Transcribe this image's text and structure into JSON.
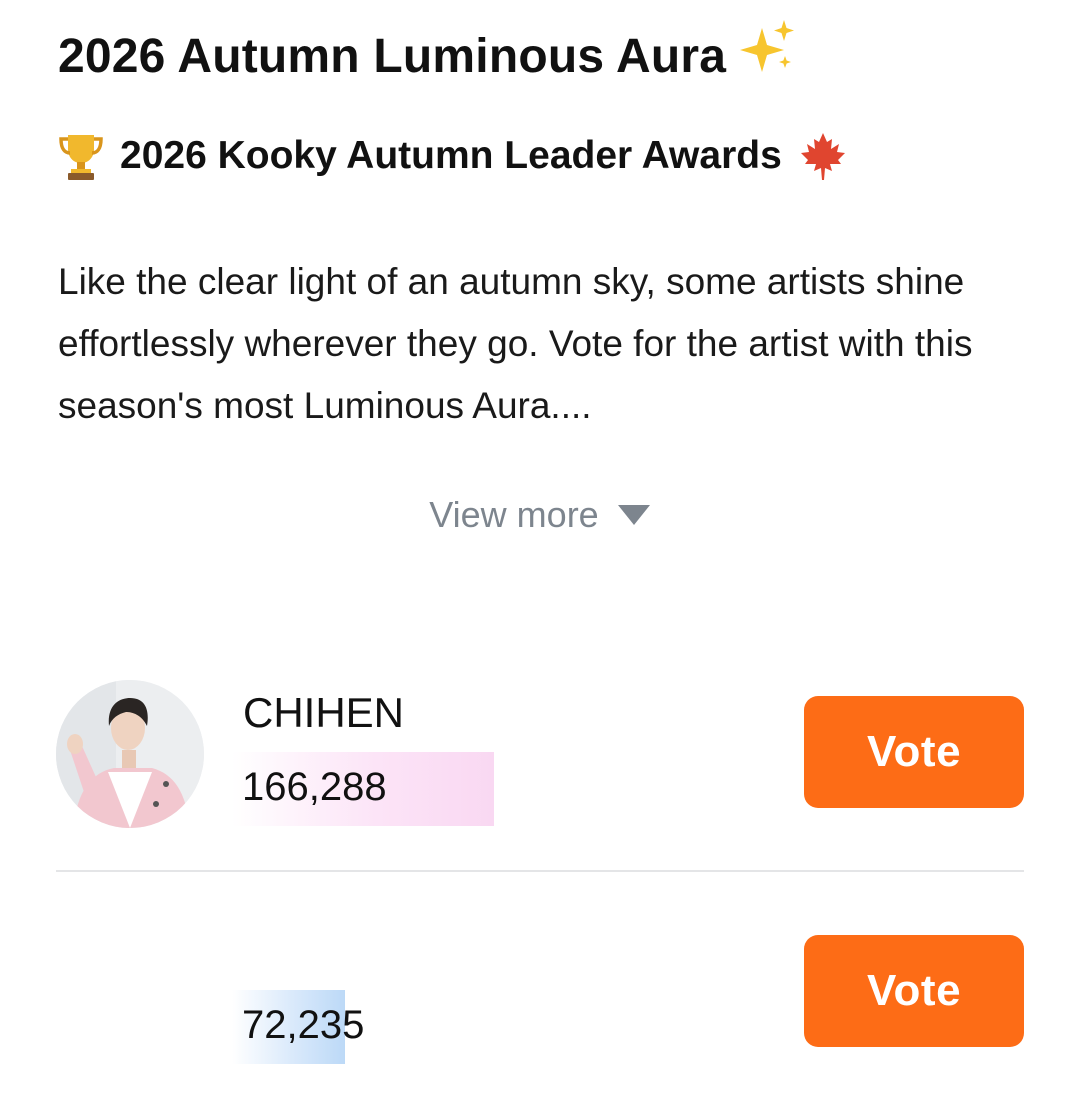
{
  "header": {
    "title": "2026 Autumn Luminous Aura",
    "title_icon": "sparkles-icon",
    "subtitle": "2026 Kooky Autumn Leader Awards",
    "subtitle_icons": [
      "trophy-icon",
      "maple-leaf-icon"
    ]
  },
  "description": {
    "text": "Like the clear light of an autumn sky, some artists shine effortlessly wherever they go. Vote for the artist with this season's most Luminous Aura....",
    "view_more_label": "View more",
    "view_more_icon": "caret-down-icon"
  },
  "candidates": [
    {
      "name": "CHIHEN",
      "votes": "166,288",
      "vote_label": "Vote",
      "bar_color": "#f9d8f2"
    },
    {
      "name": "",
      "votes": "72,235",
      "vote_label": "Vote",
      "bar_color": "#bcd9f7"
    }
  ],
  "colors": {
    "vote_button": "#fd6c16",
    "muted_text": "#7d858e",
    "divider": "#e4e5e7"
  }
}
